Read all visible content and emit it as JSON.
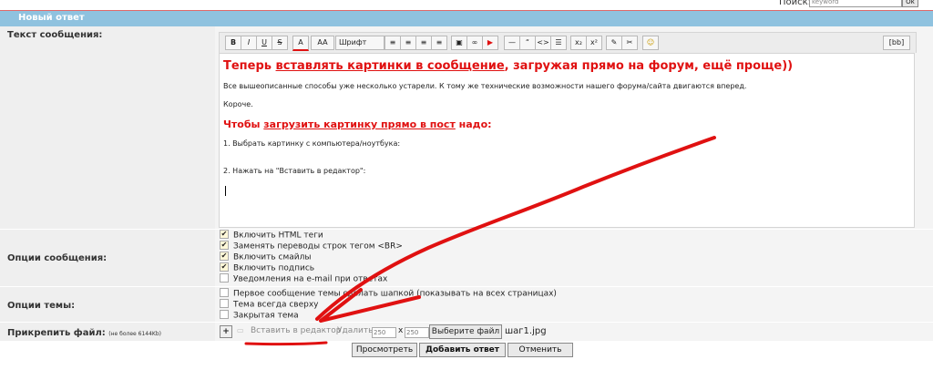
{
  "search": {
    "label": "Поиск:",
    "placeholder": "keyword",
    "button": "Ок"
  },
  "header": {
    "title": "Новый ответ"
  },
  "labels": {
    "message": "Текст сообщения:",
    "message_options": "Опции сообщения:",
    "topic_options": "Опции темы:",
    "attach": "Прикрепить файл:",
    "attach_note": "(не более 6144Kb)"
  },
  "toolbar": {
    "bold": "B",
    "italic": "I",
    "underline": "U",
    "strike": "S",
    "font_color": "A",
    "font_size": "AA",
    "font": "Шрифт",
    "quote": "“",
    "code": "<>",
    "sub": "x₂",
    "sup": "x²",
    "bbcode": "[bb]"
  },
  "editor": {
    "heading_pre": "Теперь ",
    "heading_link": "вставлять картинки в сообщение",
    "heading_post": ", загружая прямо на форум, ещё проще))",
    "line1": "Все вышеописанные способы уже несколько устарели. К тому же технические возможности нашего форума/сайта двигаются вперед.",
    "line2": "Короче.",
    "sub_pre": "Чтобы ",
    "sub_link": "загрузить картинку прямо в пост",
    "sub_post": " надо:",
    "step1": "1. Выбрать картинку с компьютера/ноутбука:",
    "step2": "2. Нажать на \"Вставить в редактор\":"
  },
  "message_options": [
    {
      "label": "Включить HTML теги",
      "checked": true
    },
    {
      "label": "Заменять переводы строк тегом <BR>",
      "checked": true
    },
    {
      "label": "Включить смайлы",
      "checked": true
    },
    {
      "label": "Включить подпись",
      "checked": true
    },
    {
      "label": "Уведомления на e-mail при ответах",
      "checked": false
    }
  ],
  "topic_options": [
    {
      "label": "Первое сообщение темы сделать шапкой (показывать на всех страницах)",
      "checked": false
    },
    {
      "label": "Тема всегда сверху",
      "checked": false
    },
    {
      "label": "Закрытая тема",
      "checked": false
    }
  ],
  "attach": {
    "add": "+",
    "insert": "Вставить в редактор",
    "delete": "Удалить",
    "width": "250",
    "times": "x",
    "height": "250",
    "choose": "Выберите файл",
    "filename": "шаг1.jpg"
  },
  "actions": {
    "preview": "Просмотреть",
    "submit": "Добавить ответ",
    "cancel": "Отменить"
  },
  "colors": {
    "header": "#8fc2df",
    "highlight": "#e01111"
  }
}
